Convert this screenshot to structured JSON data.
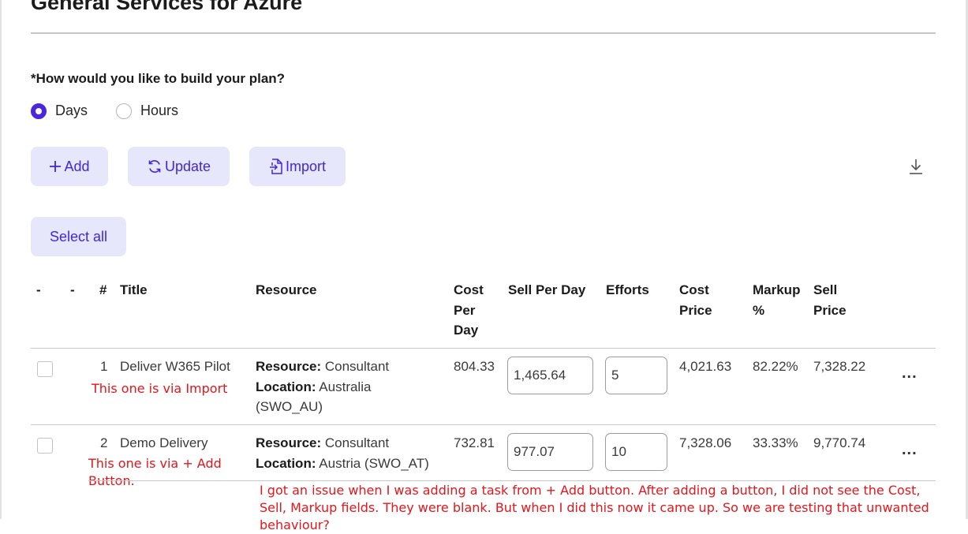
{
  "page": {
    "title": "General Services for Azure"
  },
  "plan": {
    "question": "*How would you like to build your plan?",
    "options": [
      {
        "label": "Days",
        "selected": true
      },
      {
        "label": "Hours",
        "selected": false
      }
    ]
  },
  "toolbar": {
    "add_label": "Add",
    "update_label": "Update",
    "import_label": "Import"
  },
  "select_all_label": "Select all",
  "table": {
    "headers": {
      "dash1": "-",
      "dash2": "-",
      "num": "#",
      "title": "Title",
      "resource": "Resource",
      "cost_per_day": "Cost Per Day",
      "sell_per_day": "Sell Per Day",
      "efforts": "Efforts",
      "cost_price": "Cost Price",
      "markup": "Markup %",
      "sell_price": "Sell Price"
    },
    "rows": [
      {
        "num": "1",
        "title": "Deliver W365 Pilot",
        "resource_label": "Resource:",
        "resource_value": "Consultant",
        "location_label": "Location:",
        "location_value": "Australia (SWO_AU)",
        "cost_per_day": "804.33",
        "sell_per_day": "1,465.64",
        "efforts": "5",
        "cost_price": "4,021.63",
        "markup": "82.22%",
        "sell_price": "7,328.22",
        "more": "..."
      },
      {
        "num": "2",
        "title": "Demo Delivery",
        "resource_label": "Resource:",
        "resource_value": "Consultant",
        "location_label": "Location:",
        "location_value": "Austria (SWO_AT)",
        "cost_per_day": "732.81",
        "sell_per_day": "977.07",
        "efforts": "10",
        "cost_price": "7,328.06",
        "markup": "33.33%",
        "sell_price": "9,770.74",
        "more": "..."
      }
    ]
  },
  "annotations": {
    "row1_note": "This one is via Import",
    "row2_note": "This one is via + Add Button.",
    "issue_note": "I got an issue when I was adding a task from + Add button. After adding a button, I did not see the Cost, Sell,  Markup fields. They were blank. But when I did this now it came up. So we are testing that unwanted behaviour?"
  },
  "colors": {
    "accent": "#4326d6",
    "button_bg": "#e6e7fb",
    "annotation": "#e5151b"
  },
  "icons": {
    "add": "plus-icon",
    "update": "refresh-icon",
    "import": "import-file-icon",
    "download": "download-icon"
  }
}
